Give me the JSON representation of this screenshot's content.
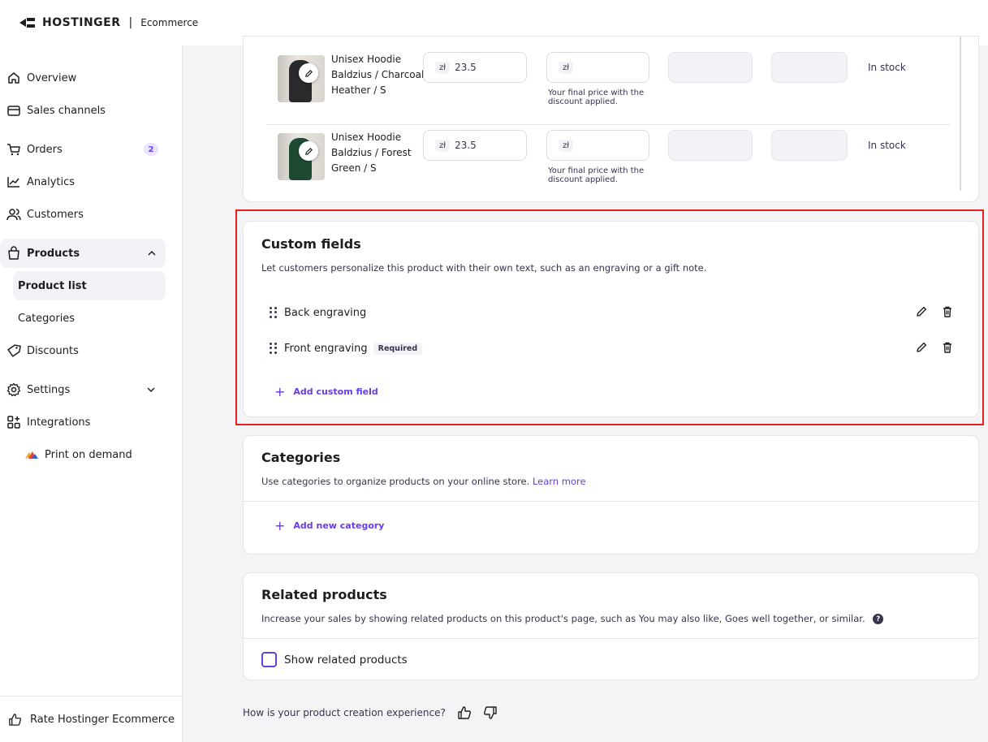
{
  "header": {
    "brand": "HOSTINGER",
    "separator": "|",
    "product": "Ecommerce"
  },
  "sidebar": {
    "items": [
      {
        "label": "Overview",
        "icon": "home-icon"
      },
      {
        "label": "Sales channels",
        "icon": "store-icon"
      },
      {
        "label": "Orders",
        "icon": "cart-icon",
        "badge": "2"
      },
      {
        "label": "Analytics",
        "icon": "chart-line-icon"
      },
      {
        "label": "Customers",
        "icon": "users-icon"
      },
      {
        "label": "Products",
        "icon": "bag-icon",
        "expanded": true
      },
      {
        "label": "Product list",
        "sub": true,
        "active": true
      },
      {
        "label": "Categories",
        "sub": true
      },
      {
        "label": "Discounts",
        "icon": "tag-icon"
      },
      {
        "label": "Settings",
        "icon": "gear-icon",
        "expanded": false
      },
      {
        "label": "Integrations",
        "icon": "apps-add-icon"
      },
      {
        "label": "Print on demand",
        "icon": "printful-logo-icon"
      }
    ],
    "bottom": {
      "label": "Rate Hostinger Ecommerce",
      "icon": "thumbs-up-icon"
    }
  },
  "variants": [
    {
      "name": "Unisex Hoodie Baldzius / Charcoal Heather / S",
      "currency": "zł",
      "price": "23.5",
      "discount_currency": "zł",
      "discount_value": "",
      "hint": "Your final price with the discount applied.",
      "status": "In stock",
      "color": "#2a2a2c"
    },
    {
      "name": "Unisex Hoodie Baldzius / Forest Green / S",
      "currency": "zł",
      "price": "23.5",
      "discount_currency": "zł",
      "discount_value": "",
      "hint": "Your final price with the discount applied.",
      "status": "In stock",
      "color": "#1f4a32"
    }
  ],
  "custom_fields": {
    "title": "Custom fields",
    "description": "Let customers personalize this product with their own text, such as an engraving or a gift note.",
    "fields": [
      {
        "label": "Back engraving",
        "required": false
      },
      {
        "label": "Front engraving",
        "required": true,
        "required_label": "Required"
      }
    ],
    "add_label": "Add custom field"
  },
  "categories": {
    "title": "Categories",
    "description": "Use categories to organize products on your online store.",
    "learn_more": "Learn more",
    "add_label": "Add new category"
  },
  "related": {
    "title": "Related products",
    "description": "Increase your sales by showing related products on this product's page, such as You may also like, Goes well together, or similar.",
    "help": "?",
    "checkbox_label": "Show related products",
    "checked": false
  },
  "feedback": {
    "question": "How is your product creation experience?"
  },
  "colors": {
    "accent": "#673de6",
    "highlight": "#e3211f"
  }
}
